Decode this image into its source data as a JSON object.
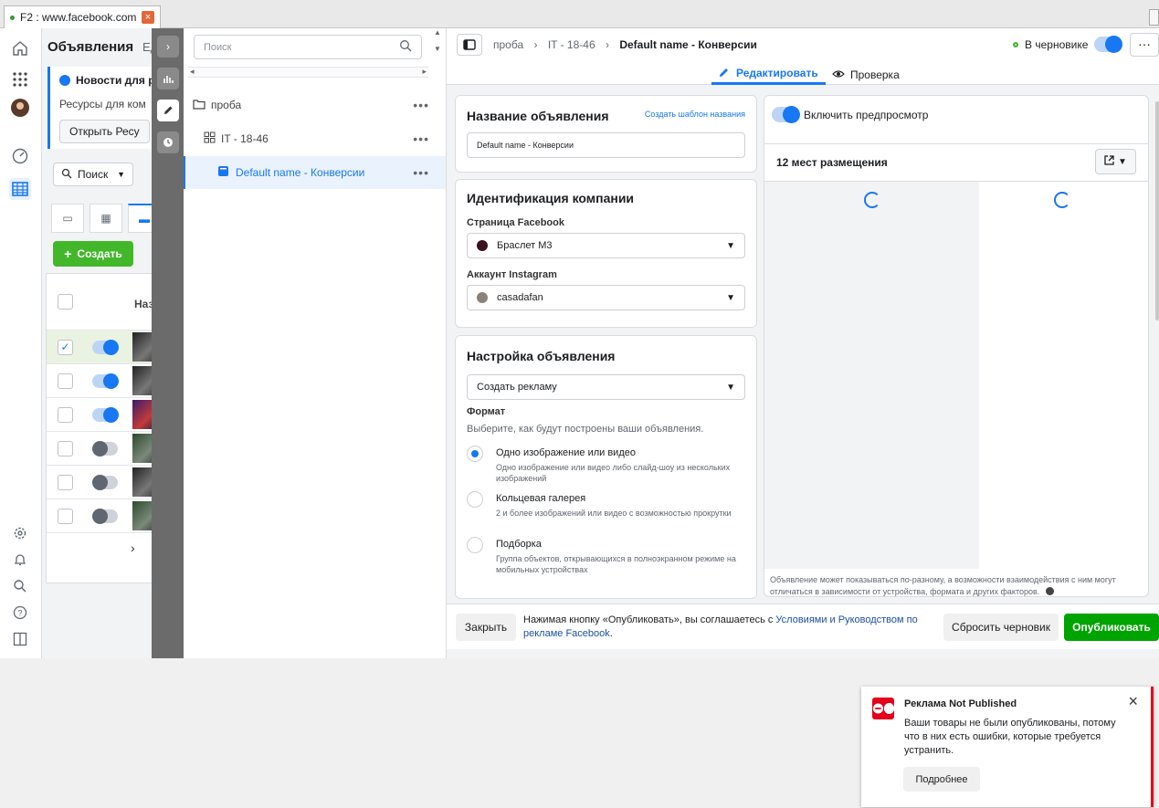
{
  "browser": {
    "tab_title": "F2 : www.facebook.com",
    "close_glyph": "×"
  },
  "rail": {
    "icons": [
      "home-icon",
      "apps-grid-icon",
      "avatar",
      "dashboard-icon",
      "table-icon",
      "gear-icon",
      "bell-icon",
      "search-icon",
      "help-icon",
      "sidebar-icon"
    ]
  },
  "background": {
    "title": "Объявления",
    "title_suffix": "Ед",
    "news_title": "Новости для ре",
    "news_body": "Ресурсы для ком",
    "news_button": "Открыть Ресу",
    "search_label": "Поиск",
    "create_label": "Создать",
    "column_header": "Назв"
  },
  "tree": {
    "search_placeholder": "Поиск",
    "nodes": [
      {
        "label": "проба",
        "more": "•••"
      },
      {
        "label": "IT - 18-46",
        "more": "•••"
      },
      {
        "label": "Default name - Конверсии",
        "more": "•••"
      }
    ]
  },
  "topbar": {
    "crumb_1": "проба",
    "crumb_2": "IT - 18-46",
    "crumb_3": "Default name - Конверсии",
    "sep": "›",
    "draft_label": "В черновике",
    "more": "···",
    "tab_edit": "Редактировать",
    "tab_review": "Проверка"
  },
  "ad_name": {
    "heading": "Название объявления",
    "template_link": "Создать шаблон названия",
    "value": "Default name - Конверсии"
  },
  "identity": {
    "heading": "Идентификация компании",
    "fb_label": "Страница Facebook",
    "fb_value": "Браслет М3",
    "ig_label": "Аккаунт Instagram",
    "ig_value": "casadafan"
  },
  "setup": {
    "heading": "Настройка объявления",
    "select_value": "Создать рекламу",
    "format_label": "Формат",
    "format_hint": "Выберите, как будут построены ваши объявления.",
    "options": [
      {
        "title": "Одно изображение или видео",
        "desc": "Одно изображение или видео либо слайд-шоу из нескольких изображений",
        "selected": true
      },
      {
        "title": "Кольцевая галерея",
        "desc": "2 и более изображений или видео с возможностью прокрутки",
        "selected": false
      },
      {
        "title": "Подборка",
        "desc": "Группа объектов, открывающихся в полноэкранном режиме на мобильных устройствах",
        "selected": false
      }
    ]
  },
  "preview": {
    "toggle_label": "Включить предпросмотр",
    "placements": "12 мест размещения",
    "note": "Объявление может показываться по-разному, а возможности взаимодействия с ним могут отличаться в зависимости от устройства, формата и других факторов."
  },
  "bottom": {
    "close": "Закрыть",
    "terms_prefix": "Нажимая кнопку «Опубликовать», вы соглашаетесь с ",
    "terms_link": "Условиями и Руководством по рекламе Facebook",
    "terms_suffix": ".",
    "reset": "Сбросить черновик",
    "publish": "Опубликовать"
  },
  "toast": {
    "title": "Реклама Not Published",
    "body": "Ваши товары не были опубликованы, потому что в них есть ошибки, которые требуется устранить.",
    "more": "Подробнее",
    "close": "×"
  },
  "colors": {
    "accent": "#1877f2",
    "publish": "#00a400",
    "create": "#42b72a",
    "error": "#e4001b"
  }
}
